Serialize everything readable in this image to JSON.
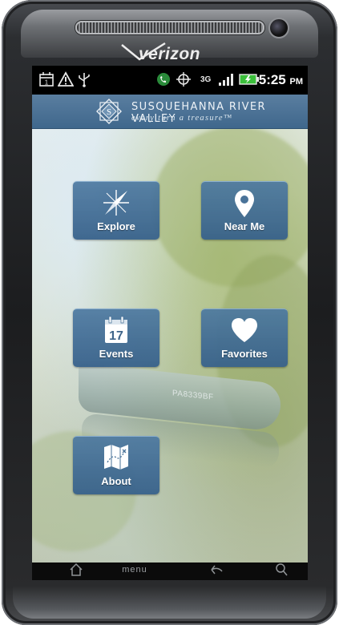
{
  "device": {
    "carrier": "verizon"
  },
  "status_bar": {
    "icons_left": [
      "calendar-icon",
      "warning-icon",
      "usb-icon"
    ],
    "icons_right": [
      "phone-signal-icon",
      "gps-icon",
      "3g-data-icon",
      "signal-bars-icon",
      "battery-charging-icon"
    ],
    "network": "3G",
    "time": "5:25",
    "ampm": "PM"
  },
  "header": {
    "title": "SUSQUEHANNA RIVER VALLEY",
    "tagline": "every turn a treasure™",
    "logo_letter": "S"
  },
  "background": {
    "boat_registration": "PA8339BF"
  },
  "menu": {
    "explore_label": "Explore",
    "near_me_label": "Near Me",
    "events_label": "Events",
    "events_day": "17",
    "favorites_label": "Favorites",
    "about_label": "About"
  },
  "nav_bar": {
    "menu_label": "menu"
  },
  "colors": {
    "header_blue": "#4a7196",
    "tile_blue": "#4c78a0",
    "status_bar_bg": "#000000"
  }
}
